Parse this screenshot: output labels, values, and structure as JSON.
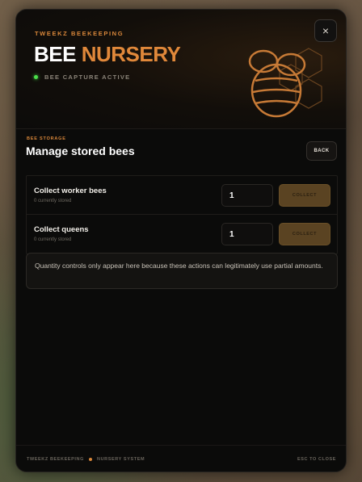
{
  "header": {
    "brand": "TWEEKZ BEEKEEPING",
    "title_white": "BEE",
    "title_orange": "NURSERY",
    "status": "BEE CAPTURE ACTIVE",
    "close_label": "×"
  },
  "section": {
    "kicker": "BEE STORAGE",
    "title": "Manage stored bees",
    "back_label": "BACK"
  },
  "rows": [
    {
      "title": "Collect worker bees",
      "subtitle": "0 currently stored",
      "quantity": "1",
      "button": "COLLECT"
    },
    {
      "title": "Collect queens",
      "subtitle": "0 currently stored",
      "quantity": "1",
      "button": "COLLECT"
    }
  ],
  "note": "Quantity controls only appear here because these actions can legitimately use partial amounts.",
  "footer": {
    "left_a": "TWEEKZ BEEKEEPING",
    "left_b": "NURSERY SYSTEM",
    "right": "ESC TO CLOSE"
  },
  "colors": {
    "accent": "#e0883a",
    "status_dot": "#4ae04a",
    "collect_bg": "#5a4322"
  }
}
